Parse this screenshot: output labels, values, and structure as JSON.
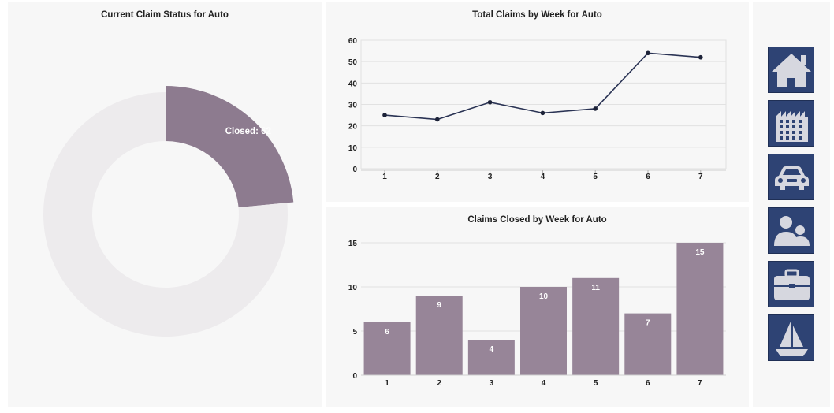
{
  "donut": {
    "title": "Current Claim Status for Auto",
    "colors": {
      "closed": "#8d7b8f",
      "remaining": "#edebed"
    }
  },
  "nav": [
    {
      "icon": "home-icon"
    },
    {
      "icon": "building-icon"
    },
    {
      "icon": "car-icon"
    },
    {
      "icon": "users-icon"
    },
    {
      "icon": "briefcase-icon"
    },
    {
      "icon": "sailboat-icon"
    }
  ],
  "theme": {
    "nav_tile": "#2e4374",
    "nav_icon": "#d6d7df",
    "line": "#2a3354",
    "bar": "#978598"
  },
  "chart_data": [
    {
      "type": "pie",
      "title": "Current Claim Status for Auto",
      "slices": [
        {
          "label": "Closed",
          "value": 62,
          "display": "Closed: 62",
          "color": "#8d7b8f"
        },
        {
          "label": "",
          "value": 202,
          "color": "#edebed"
        }
      ],
      "donut": true
    },
    {
      "type": "line",
      "title": "Total Claims by Week for Auto",
      "x": [
        "1",
        "2",
        "3",
        "4",
        "5",
        "6",
        "7"
      ],
      "values": [
        25,
        23,
        31,
        26,
        28,
        54,
        52
      ],
      "ylim": [
        0,
        60
      ],
      "yticks": [
        "0",
        "10",
        "20",
        "30",
        "40",
        "50",
        "60"
      ],
      "grid": true
    },
    {
      "type": "bar",
      "title": "Claims Closed by Week for Auto",
      "categories": [
        "1",
        "2",
        "3",
        "4",
        "5",
        "6",
        "7"
      ],
      "values": [
        6,
        9,
        4,
        10,
        11,
        7,
        15
      ],
      "labels": [
        "6",
        "9",
        "4",
        "10",
        "11",
        "7",
        "15"
      ],
      "ylim": [
        0,
        15
      ],
      "yticks": [
        "0",
        "5",
        "10",
        "15"
      ],
      "grid": true
    }
  ]
}
